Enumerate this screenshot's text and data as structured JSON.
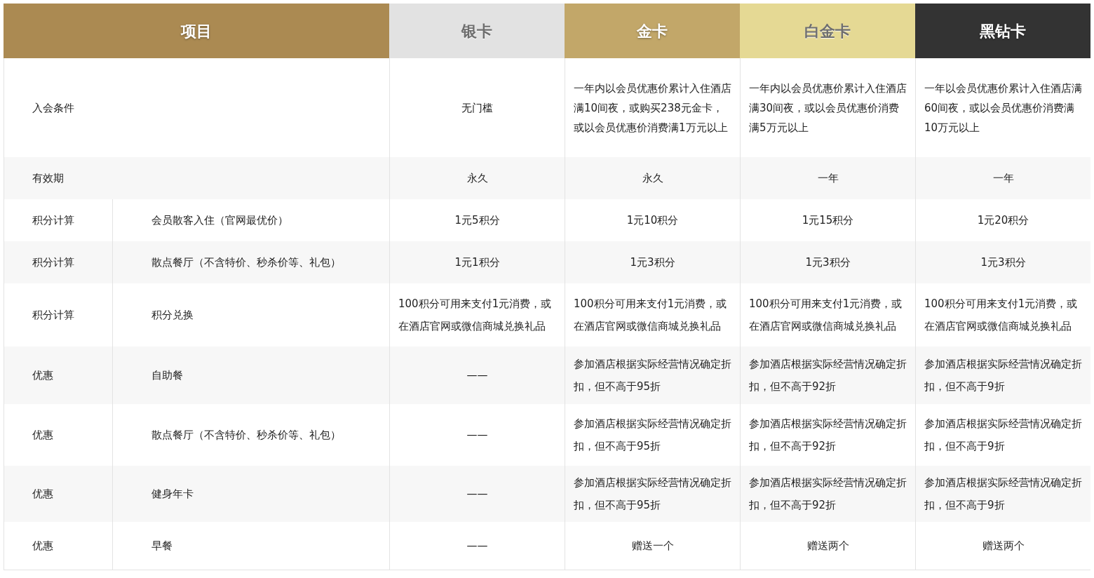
{
  "columns": [
    {
      "label": "项目",
      "color": "#ab8a52"
    },
    {
      "label": "银卡",
      "color": "#e2e2e2"
    },
    {
      "label": "金卡",
      "color": "#c2a769"
    },
    {
      "label": "白金卡",
      "color": "#e5d994"
    },
    {
      "label": "黑钻卡",
      "color": "#333333"
    }
  ],
  "rows": [
    {
      "category": "入会条件",
      "cells": [
        "无门槛",
        "一年内以会员优惠价累计入住酒店满10间夜，或购买238元金卡，或以会员优惠价消费满1万元以上",
        "一年内以会员优惠价累计入住酒店满30间夜，或以会员优惠价消费满5万元以上",
        "一年以会员优惠价累计入住酒店满60间夜，或以会员优惠价消费满10万元以上"
      ]
    },
    {
      "category": "有效期",
      "cells": [
        "永久",
        "永久",
        "一年",
        "一年"
      ]
    },
    {
      "category": "积分计算",
      "item": "会员散客入住（官网最优价）",
      "cells": [
        "1元5积分",
        "1元10积分",
        "1元15积分",
        "1元20积分"
      ]
    },
    {
      "category": "积分计算",
      "item": "散点餐厅（不含特价、秒杀价等、礼包）",
      "cells": [
        "1元1积分",
        "1元3积分",
        "1元3积分",
        "1元3积分"
      ]
    },
    {
      "category": "积分计算",
      "item": "积分兑换",
      "cells": [
        "100积分可用来支付1元消费，或在酒店官网或微信商城兑换礼品",
        "100积分可用来支付1元消费，或在酒店官网或微信商城兑换礼品",
        "100积分可用来支付1元消费，或在酒店官网或微信商城兑换礼品",
        "100积分可用来支付1元消费，或在酒店官网或微信商城兑换礼品"
      ]
    },
    {
      "category": "优惠",
      "item": "自助餐",
      "cells": [
        "——",
        "参加酒店根据实际经营情况确定折扣，但不高于95折",
        "参加酒店根据实际经营情况确定折扣，但不高于92折",
        "参加酒店根据实际经营情况确定折扣，但不高于9折"
      ]
    },
    {
      "category": "优惠",
      "item": "散点餐厅（不含特价、秒杀价等、礼包）",
      "cells": [
        "——",
        "参加酒店根据实际经营情况确定折扣，但不高于95折",
        "参加酒店根据实际经营情况确定折扣，但不高于92折",
        "参加酒店根据实际经营情况确定折扣，但不高于9折"
      ]
    },
    {
      "category": "优惠",
      "item": "健身年卡",
      "cells": [
        "——",
        "参加酒店根据实际经营情况确定折扣，但不高于95折",
        "参加酒店根据实际经营情况确定折扣，但不高于92折",
        "参加酒店根据实际经营情况确定折扣，但不高于9折"
      ]
    },
    {
      "category": "优惠",
      "item": "早餐",
      "cells": [
        "——",
        "赠送一个",
        "赠送两个",
        "赠送两个"
      ]
    }
  ]
}
